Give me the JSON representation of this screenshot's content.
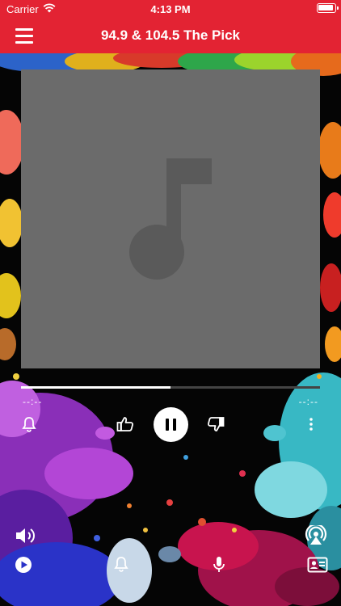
{
  "status_bar": {
    "carrier": "Carrier",
    "time": "4:13 PM"
  },
  "nav": {
    "title": "94.9 & 104.5 The Pick"
  },
  "player": {
    "elapsed": "--:--",
    "remaining": "--:--",
    "progress": 0.5
  },
  "colors": {
    "brand_red": "#e32333",
    "album_placeholder": "#6b6b6b"
  },
  "icons": {
    "menu": "hamburger-icon",
    "album_placeholder": "music-note-icon",
    "alarm": "bell-icon",
    "like": "thumbs-up-icon",
    "pause": "pause-icon",
    "dislike": "thumbs-down-icon",
    "more": "more-vertical-icon",
    "volume": "speaker-icon",
    "airplay": "airplay-icon",
    "play": "play-circle-icon",
    "sleep": "bell-icon",
    "mic": "microphone-icon",
    "contact": "contact-card-icon"
  }
}
